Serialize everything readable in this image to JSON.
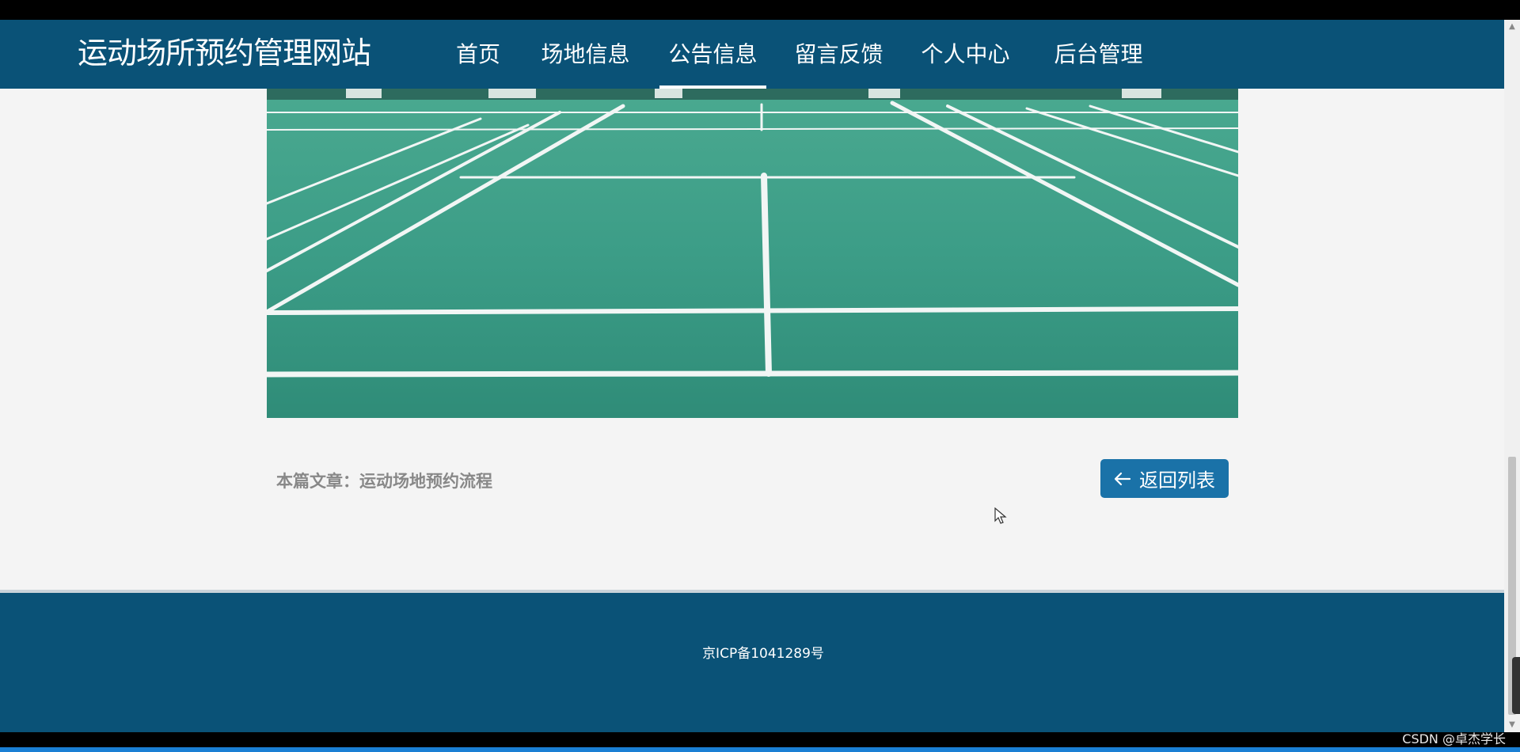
{
  "header": {
    "brand": "运动场所预约管理网站",
    "nav": [
      {
        "label": "首页"
      },
      {
        "label": "场地信息"
      },
      {
        "label": "公告信息",
        "active": true
      },
      {
        "label": "留言反馈"
      },
      {
        "label": "个人中心"
      },
      {
        "label": "后台管理"
      }
    ]
  },
  "article": {
    "label": "本篇文章：运动场地预约流程",
    "back_label": "返回列表"
  },
  "footer": {
    "icp": "京ICP备1041289号"
  },
  "watermark": "CSDN @卓杰学长",
  "colors": {
    "brand": "#0a5277",
    "button": "#1a72a8",
    "court": "#3a9c86"
  }
}
